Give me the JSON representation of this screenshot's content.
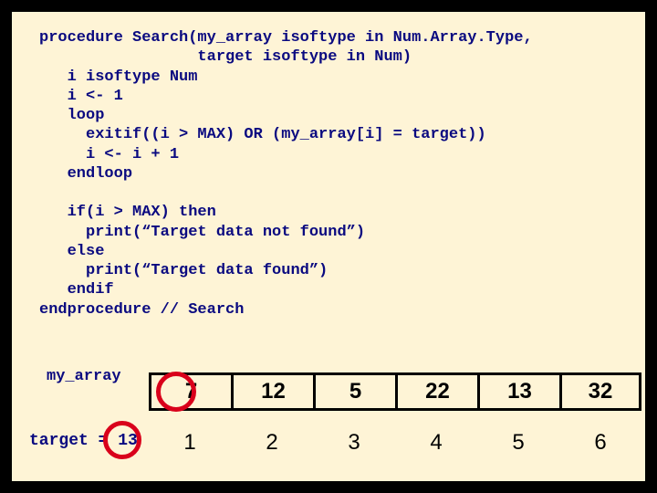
{
  "code": {
    "l1": "procedure Search(my_array isoftype in Num.Array.Type,",
    "l2": "                 target isoftype in Num)",
    "l3": "   i isoftype Num",
    "l4": "   i <- 1",
    "l5": "   loop",
    "l6": "     exitif((i > MAX) OR (my_array[i] = target))",
    "l7": "     i <- i + 1",
    "l8": "   endloop",
    "l9": "",
    "l10": "   if(i > MAX) then",
    "l11": "     print(“Target data not found”)",
    "l12": "   else",
    "l13": "     print(“Target data found”)",
    "l14": "   endif",
    "l15": "endprocedure // Search"
  },
  "array_label": "my_array",
  "target_label": "target = 13",
  "cells": {
    "c0": "7",
    "c1": "12",
    "c2": "5",
    "c3": "22",
    "c4": "13",
    "c5": "32"
  },
  "indices": {
    "i0": "1",
    "i1": "2",
    "i2": "3",
    "i3": "4",
    "i4": "5",
    "i5": "6"
  }
}
